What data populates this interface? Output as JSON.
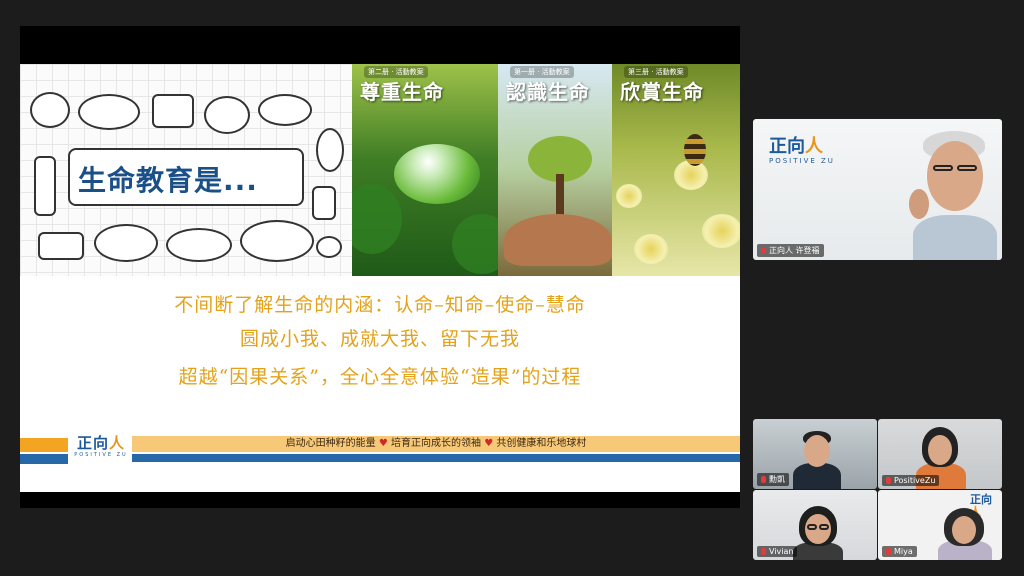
{
  "slide": {
    "title": "生命教育是...",
    "books": [
      {
        "tag": "第二册 · 活動教案",
        "name": "尊重生命"
      },
      {
        "tag": "第一册 · 活動教案",
        "name": "認識生命"
      },
      {
        "tag": "第三册 · 活動教案",
        "name": "欣賞生命"
      }
    ],
    "lines": [
      "不间断了解生命的内涵：认命–知命–使命–慧命",
      "圆成小我、成就大我、留下无我",
      "超越“因果关系”，全心全意体验“造果”的过程"
    ],
    "footer": {
      "logo_zh": "正向",
      "logo_ren": "人",
      "logo_en": "POSITIVE ZU",
      "slogan_1": "启动心田种籽的能量",
      "slogan_2": "培育正向成长的领袖",
      "slogan_3": "共创健康和乐地球村",
      "heart": "♥"
    }
  },
  "video": {
    "main": {
      "label": "正向人 许登福",
      "logo_zh": "正向",
      "logo_ren": "人",
      "logo_en": "POSITIVE ZU"
    },
    "tiles": [
      {
        "label": "勳凱"
      },
      {
        "label": "PositiveZu"
      },
      {
        "label": "Vivian"
      },
      {
        "label": "Miya",
        "logo_zh": "正向",
        "logo_ren": "人"
      }
    ]
  },
  "colors": {
    "accent_orange": "#e3a21a",
    "brand_blue": "#1d5a9b",
    "title_blue": "#1b4f87"
  }
}
